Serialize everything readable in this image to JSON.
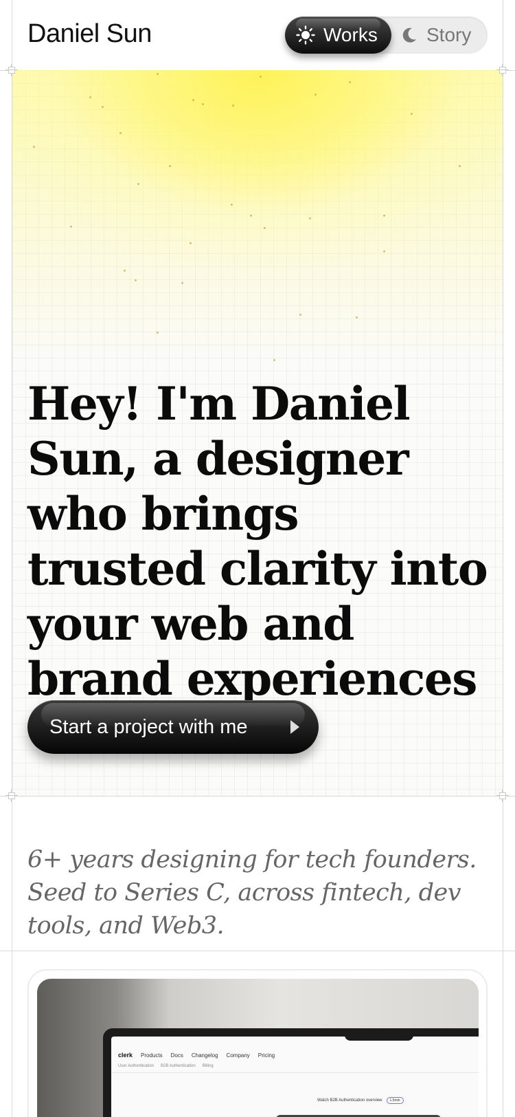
{
  "header": {
    "brand": "Daniel Sun",
    "theme_toggle": {
      "active_label": "Works",
      "active_icon": "sun-icon",
      "inactive_label": "Story",
      "inactive_icon": "moon-icon"
    }
  },
  "hero": {
    "headline": "Hey! I'm Daniel Sun, a designer who brings trusted clarity into your web and brand experiences",
    "cta_label": "Start a project with me",
    "cta_icon": "play-arrow-icon",
    "accent_color": "#fff04a"
  },
  "intro": {
    "text": "6+ years designing for tech founders. Seed to Series C, across fintech, dev tools, and Web3."
  },
  "work_card": {
    "screen": {
      "logo": "clerk",
      "nav_items": [
        "Products",
        "Docs",
        "Changelog",
        "Company",
        "Pricing"
      ],
      "sub_items": [
        "User Authentication",
        "B2B Authentication",
        "Billing"
      ],
      "pill_text": "Watch B2B Authentication overview",
      "pill_badge": "1.5min"
    }
  }
}
